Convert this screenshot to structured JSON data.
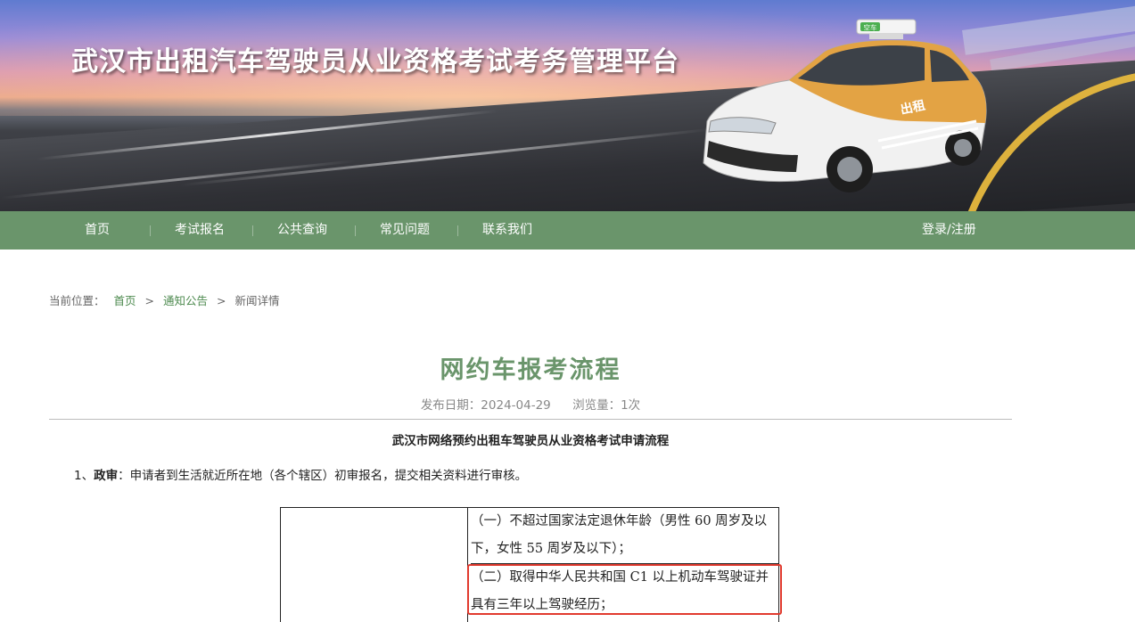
{
  "banner": {
    "title": "武汉市出租汽车驾驶员从业资格考试考务管理平台",
    "taxi_door_text": "出租",
    "taxi_roof_text": "空车"
  },
  "nav": {
    "items": [
      "首页",
      "考试报名",
      "公共查询",
      "常见问题",
      "联系我们"
    ],
    "login_label": "登录/注册",
    "background_color": "#6a956b"
  },
  "breadcrumb": {
    "prefix": "当前位置：",
    "items": [
      "首页",
      "通知公告",
      "新闻详情"
    ],
    "separator": ">"
  },
  "article": {
    "title": "网约车报考流程",
    "publish_date_label": "发布日期：2024-04-29",
    "views_label": "浏览量：1次",
    "subtitle": "武汉市网络预约出租车驾驶员从业资格考试申请流程",
    "step1_number": "1、",
    "step1_label": "政审",
    "step1_text": "：申请者到生活就近所在地（各个辖区）初审报名，提交相关资料进行审核。",
    "requirements": [
      "（一）不超过国家法定退休年龄（男性 60 周岁及以下，女性 55 周岁及以下）；",
      "（二）取得中华人民共和国 C1 以上机动车驾驶证并具有三年以上驾驶经历；"
    ],
    "title_color": "#6a956b",
    "highlight_color": "#e13a2e"
  }
}
